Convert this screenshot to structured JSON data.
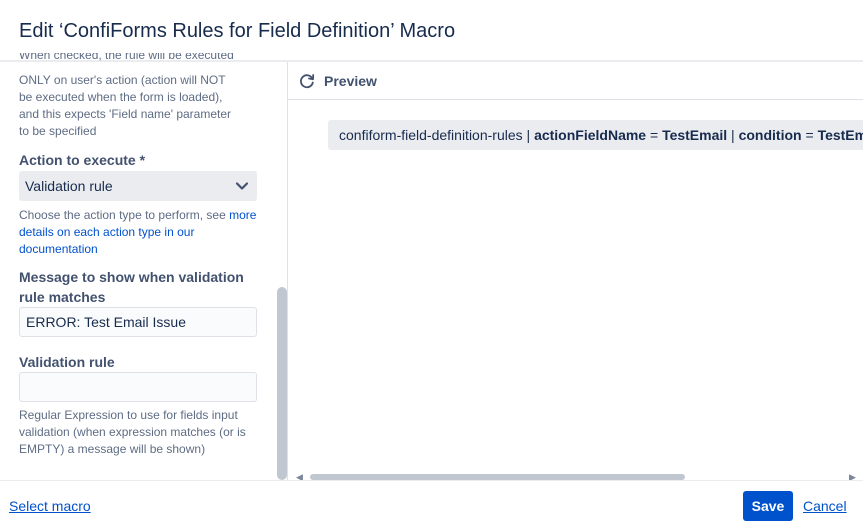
{
  "dialog": {
    "title": "Edit ‘ConfiForms Rules for Field Definition’ Macro"
  },
  "left_panel": {
    "cut_help": [
      "When checked, the rule will be executed",
      "ONLY on user's action (action will NOT",
      "be executed when the form is loaded),",
      "and this expects 'Field name' parameter",
      "to be specified"
    ],
    "action_label": "Action to execute *",
    "action_value": "Validation rule",
    "action_help_prefix": "Choose the action type to perform, see ",
    "action_help_link": "more details on each action type in our documentation",
    "message_label": "Message to show when validation rule matches",
    "message_value": "ERROR: Test Email Issue",
    "rule_label": "Validation rule",
    "rule_value": "",
    "rule_help": "Regular Expression to use for fields input validation (when expression matches (or is EMPTY) a message will be shown)"
  },
  "preview": {
    "label": "Preview",
    "macro_name": "confiform-field-definition-rules",
    "sep": " | ",
    "p1_key": "actionFieldName",
    "eq": " = ",
    "p1_val": "TestEmail",
    "p2_key": "condition",
    "p2_val": "TestEmail"
  },
  "footer": {
    "select_macro": "Select macro",
    "save": "Save",
    "cancel": "Cancel"
  },
  "colors": {
    "primary": "#0052cc",
    "text": "#172b4d",
    "muted": "#5e6c84"
  }
}
